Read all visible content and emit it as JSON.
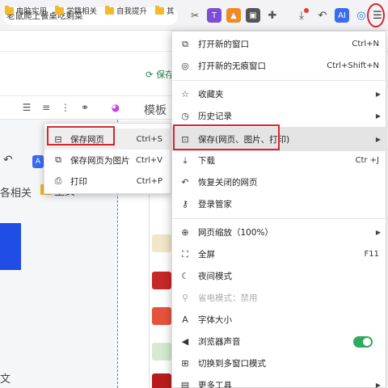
{
  "browser": {
    "tab_title": "老鼠爬上餐桌吃剩菜",
    "bookmarks": [
      {
        "label": "电脑实用"
      },
      {
        "label": "学籍相关"
      },
      {
        "label": "自我提升"
      },
      {
        "label": "其"
      }
    ],
    "menu_button_icon": "hamburger-menu-icon",
    "toolbar_ai_label": "AI"
  },
  "page": {
    "save_hint": "保存",
    "right_column_title": "模板",
    "inner_bookmark": "各相关",
    "inner_folder": "生女",
    "inner_text": "文",
    "inner_ai": "A"
  },
  "submenu": {
    "items": [
      {
        "label": "保存网页",
        "shortcut": "Ctrl+S",
        "icon": "save-page-icon"
      },
      {
        "label": "保存网页为图片",
        "shortcut": "Ctrl+V",
        "icon": "save-image-icon"
      },
      {
        "label": "打印",
        "shortcut": "Ctrl+P",
        "icon": "print-icon"
      }
    ]
  },
  "menu": {
    "items": [
      {
        "label": "打开新的窗口",
        "shortcut": "Ctrl+N",
        "icon": "new-window-icon"
      },
      {
        "label": "打开新的无痕窗口",
        "shortcut": "Ctrl+Shift+N",
        "icon": "incognito-icon"
      },
      {
        "label": "收藏夹",
        "icon": "favorites-icon"
      },
      {
        "label": "历史记录",
        "icon": "history-icon"
      },
      {
        "label": "保存(网页、图片、打印)",
        "icon": "save-icon"
      },
      {
        "label": "下载",
        "shortcut": "Ctr +J",
        "icon": "download-icon"
      },
      {
        "label": "恢复关闭的网页",
        "icon": "restore-icon"
      },
      {
        "label": "登录管家",
        "icon": "key-icon"
      },
      {
        "label": "网页缩放（100%）",
        "icon": "zoom-icon"
      },
      {
        "label": "全屏",
        "shortcut": "F11",
        "icon": "fullscreen-icon"
      },
      {
        "label": "夜间模式",
        "icon": "moon-icon"
      },
      {
        "label": "省电模式：禁用",
        "icon": "power-save-icon"
      },
      {
        "label": "字体大小",
        "icon": "font-size-icon"
      },
      {
        "label": "浏览器声音",
        "icon": "sound-icon"
      },
      {
        "label": "切换到多窗口模式",
        "icon": "multi-window-icon"
      },
      {
        "label": "更多工具",
        "icon": "more-tools-icon"
      }
    ],
    "sound_enabled": true
  },
  "colors": {
    "highlight_red": "#d8262f",
    "toggle_green": "#2eab5d",
    "folder_yellow": "#f2b92b",
    "frame_blue": "#1f4de6"
  }
}
